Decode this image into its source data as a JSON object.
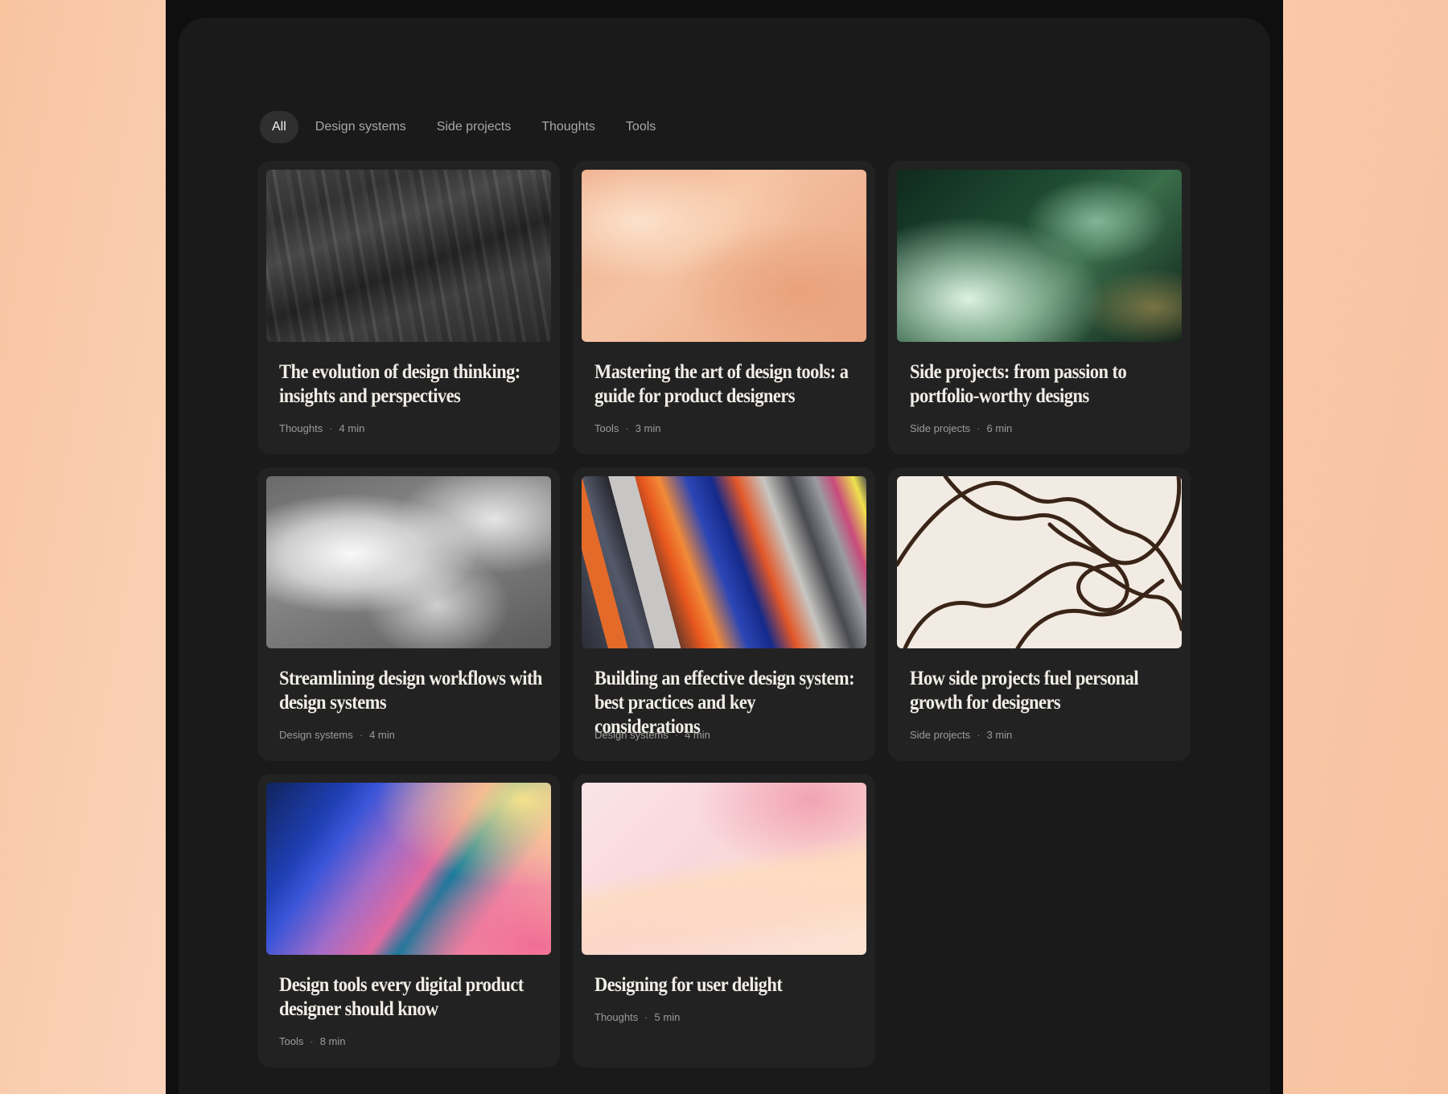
{
  "filters": {
    "tabs": [
      {
        "label": "All",
        "active": true
      },
      {
        "label": "Design systems",
        "active": false
      },
      {
        "label": "Side projects",
        "active": false
      },
      {
        "label": "Thoughts",
        "active": false
      },
      {
        "label": "Tools",
        "active": false
      }
    ]
  },
  "articles": [
    {
      "title": "The evolution of design thinking: insights and perspectives",
      "category": "Thoughts",
      "read_time": "4 min",
      "image": "charcoal-texture"
    },
    {
      "title": "Mastering the art of design tools: a guide for product designers",
      "category": "Tools",
      "read_time": "3 min",
      "image": "peach-texture"
    },
    {
      "title": "Side projects: from passion to portfolio-worthy designs",
      "category": "Side projects",
      "read_time": "6 min",
      "image": "green-blur"
    },
    {
      "title": "Streamlining design workflows with design systems",
      "category": "Design systems",
      "read_time": "4 min",
      "image": "shadow-light"
    },
    {
      "title": "Building an effective design system: best practices and key considerations",
      "category": "Design systems",
      "read_time": "4 min",
      "image": "color-strokes"
    },
    {
      "title": "How side projects fuel personal growth for designers",
      "category": "Side projects",
      "read_time": "3 min",
      "image": "line-drawing"
    },
    {
      "title": "Design tools every digital product designer should know",
      "category": "Tools",
      "read_time": "8 min",
      "image": "gradient-grain"
    },
    {
      "title": "Designing for user delight",
      "category": "Thoughts",
      "read_time": "5 min",
      "image": "blush-paint"
    }
  ],
  "meta_separator": "·",
  "colors": {
    "page_bg": "#1a1a1a",
    "card_bg": "#222222",
    "title_text": "#f1ede7",
    "meta_text": "#9c9c9c"
  }
}
